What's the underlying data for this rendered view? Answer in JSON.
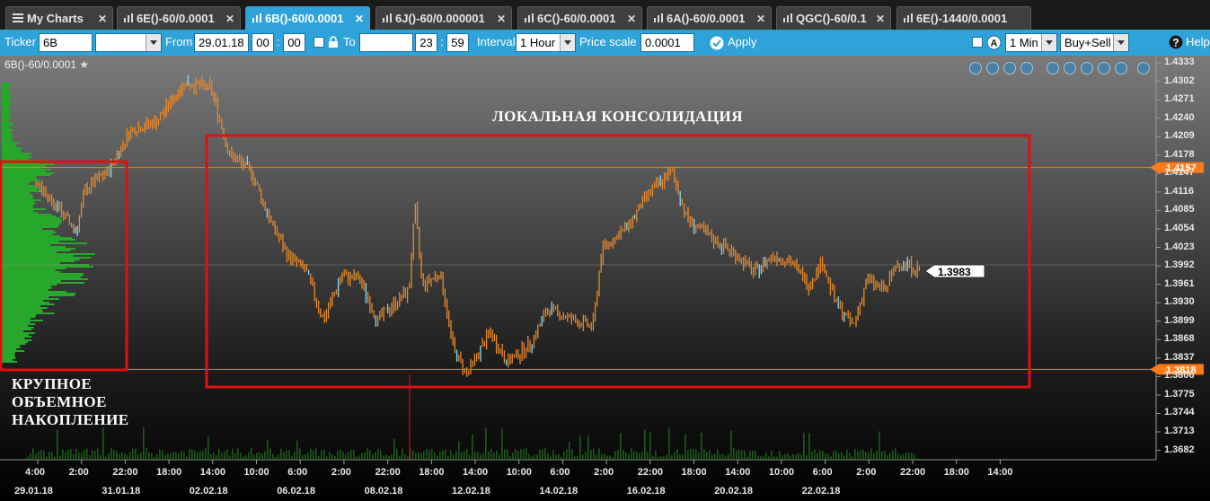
{
  "tabs": [
    {
      "label": "My Charts",
      "active": false
    },
    {
      "label": "6E()-60/0.0001",
      "active": false
    },
    {
      "label": "6B()-60/0.0001",
      "active": true
    },
    {
      "label": "6J()-60/0.000001",
      "active": false
    },
    {
      "label": "6C()-60/0.0001",
      "active": false
    },
    {
      "label": "6A()-60/0.0001",
      "active": false
    },
    {
      "label": "QGC()-60/0.1",
      "active": false
    },
    {
      "label": "6E()-1440/0.0001",
      "active": false
    }
  ],
  "toolbar": {
    "ticker_label": "Ticker",
    "ticker_value": "6B",
    "ticker_select": "",
    "from_label": "From",
    "from_date": "29.01.18",
    "from_hour": "00",
    "from_min": "00",
    "to_label": "To",
    "to_date": "",
    "to_hour": "23",
    "to_min": "59",
    "interval_label": "Interval",
    "interval_value": "1 Hour",
    "price_scale_label": "Price scale",
    "price_scale_value": "0.0001",
    "apply_label": "Apply",
    "right_interval": "1 Min",
    "right_mode": "Buy+Sell",
    "help_label": "Help"
  },
  "chart": {
    "symbol_title": "6B()-60/0.0001",
    "current_price": "1.3983",
    "levels": [
      {
        "label": "1.4157",
        "value": 1.4157,
        "color": "#ff7a1a"
      },
      {
        "label": "1.3818",
        "value": 1.3818,
        "color": "#ff7a1a"
      }
    ],
    "y_ticks": [
      "1.4333",
      "1.4302",
      "1.4271",
      "1.4240",
      "1.4209",
      "1.4178",
      "1.4147",
      "1.4116",
      "1.4085",
      "1.4054",
      "1.4023",
      "1.3992",
      "1.3961",
      "1.3930",
      "1.3899",
      "1.3868",
      "1.3837",
      "1.3806",
      "1.3775",
      "1.3744",
      "1.3713",
      "1.3682"
    ],
    "x_times": [
      "4:00",
      "2:00",
      "22:00",
      "18:00",
      "14:00",
      "10:00",
      "6:00",
      "2:00",
      "22:00",
      "18:00",
      "14:00",
      "10:00",
      "6:00",
      "2:00",
      "22:00",
      "18:00",
      "14:00",
      "10:00",
      "6:00",
      "2:00",
      "22:00",
      "18:00",
      "14:00"
    ],
    "x_dates": [
      "29.01.18",
      "31.01.18",
      "02.02.18",
      "06.02.18",
      "08.02.18",
      "12.02.18",
      "14.02.18",
      "16.02.18",
      "20.02.18",
      "22.02.18"
    ],
    "annotations": {
      "consolidation": "ЛОКАЛЬНАЯ КОНСОЛИДАЦИЯ",
      "accumulation_1": "КРУПНОЕ",
      "accumulation_2": "ОБЪЕМНОЕ",
      "accumulation_3": "НАКОПЛЕНИЕ"
    },
    "colors": {
      "candles": "#e8892a",
      "profile": "#27a82b",
      "highlight_box": "#e01010",
      "level_line": "#ff7a1a"
    }
  }
}
